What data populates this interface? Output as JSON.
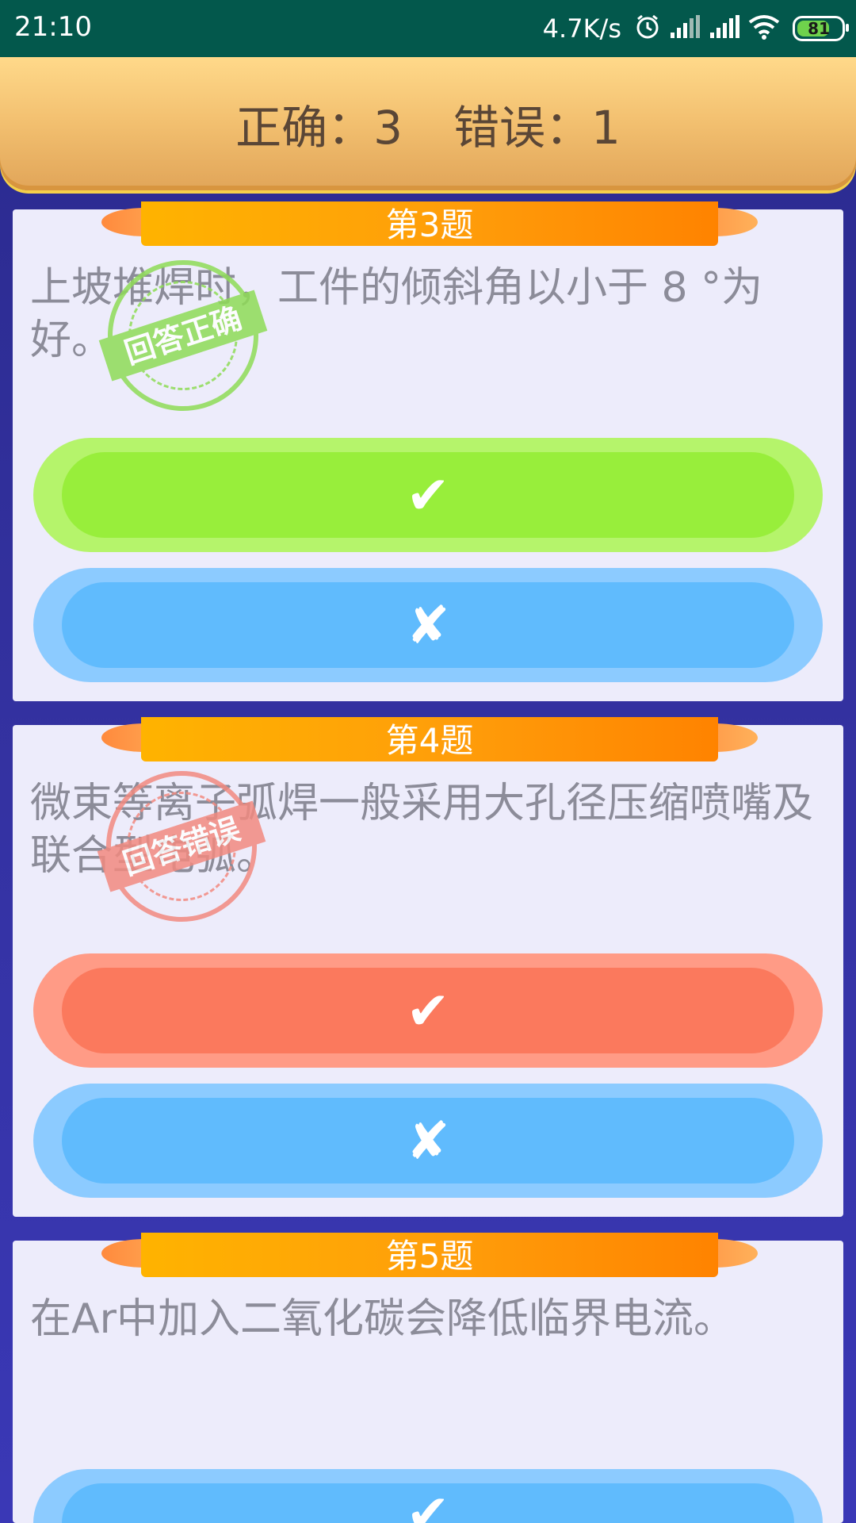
{
  "status_bar": {
    "time": "21:10",
    "speed": "4.7K/s",
    "battery": "81",
    "icons": [
      "alarm-icon",
      "signal-icon",
      "signal-icon",
      "wifi-icon",
      "battery-icon"
    ]
  },
  "score": {
    "correct_label": "正确：3",
    "wrong_label": "错误：1"
  },
  "questions": [
    {
      "title": "第3题",
      "text": "上坡堆焊时，工件的倾斜角以小于 8 °为好。",
      "stamp": "回答正确",
      "true_mark": "✔",
      "false_mark": "✘"
    },
    {
      "title": "第4题",
      "text": "微束等离子弧焊一般采用大孔径压缩喷嘴及联合型电弧。",
      "stamp": "回答错误",
      "true_mark": "✔",
      "false_mark": "✘"
    },
    {
      "title": "第5题",
      "text": "在Ar中加入二氧化碳会降低临界电流。",
      "true_mark": "✔"
    }
  ],
  "colors": {
    "status_bar": "#03584c",
    "correct_green": "#98ee3b",
    "option_blue": "#60bbfd",
    "wrong_red": "#fb795d",
    "ribbon_orange": "#ff9d0a"
  }
}
